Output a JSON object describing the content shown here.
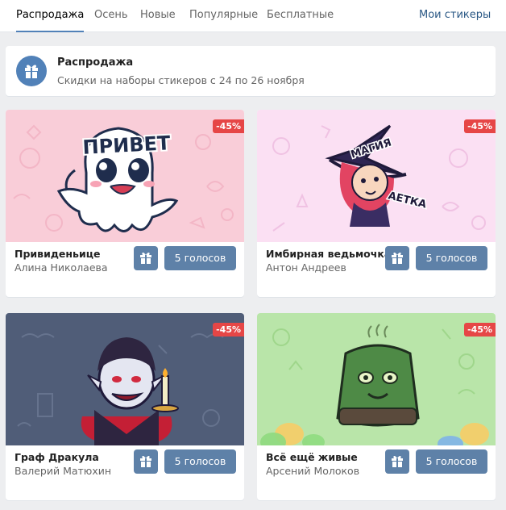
{
  "tabs": [
    {
      "label": "Распродажа",
      "active": true
    },
    {
      "label": "Осень"
    },
    {
      "label": "Новые"
    },
    {
      "label": "Популярные"
    },
    {
      "label": "Бесплатные"
    }
  ],
  "my_stickers_label": "Мои стикеры",
  "promo": {
    "icon": "gift-icon",
    "title": "Распродажа",
    "subtitle": "Скидки на наборы стикеров с 24 по 26 ноября"
  },
  "colors": {
    "accent": "#5181b8",
    "button": "#5e81a8",
    "badge": "#e64646",
    "background": "#edeef0"
  },
  "cards": [
    {
      "title": "Привиденьице",
      "author": "Алина Николаева",
      "discount": "-45%",
      "price": "5 голосов",
      "sticker_caption": "ПРИВЕТ",
      "bg_color": "#f9cdd8"
    },
    {
      "title": "Имбирная ведьмочка",
      "author": "Антон Андреев",
      "discount": "-45%",
      "price": "5 голосов",
      "sticker_caption": [
        "МАГИЯ",
        "АЕТКА"
      ],
      "bg_color": "#fbe0f3"
    },
    {
      "title": "Граф Дракула",
      "author": "Валерий Матюхин",
      "discount": "-45%",
      "price": "5 голосов",
      "bg_color": "#505d78"
    },
    {
      "title": "Всё ещё живые",
      "author": "Арсений Молоков",
      "discount": "-45%",
      "price": "5 голосов",
      "bg_color": "#b9e5a9"
    }
  ]
}
